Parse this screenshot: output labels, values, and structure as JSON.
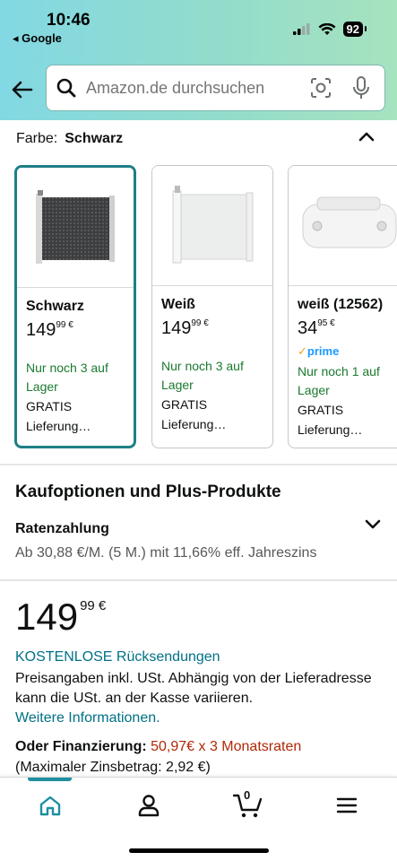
{
  "status": {
    "time": "10:46",
    "back_app": "◂ Google",
    "battery": "92"
  },
  "search": {
    "placeholder": "Amazon.de durchsuchen"
  },
  "color_selector": {
    "label": "Farbe:",
    "value": "Schwarz"
  },
  "variants": [
    {
      "name": "Schwarz",
      "price_main": "149",
      "price_cents": "99 €",
      "prime": "",
      "stock": "Nur noch 3 auf Lager",
      "delivery": "GRATIS",
      "delivery2": "Lieferung…"
    },
    {
      "name": "Weiß",
      "price_main": "149",
      "price_cents": "99 €",
      "prime": "",
      "stock": "Nur noch 3 auf Lager",
      "delivery": "GRATIS",
      "delivery2": "Lieferung…"
    },
    {
      "name": "weiß (12562)",
      "price_main": "34",
      "price_cents": "95 €",
      "prime": "prime",
      "stock": "Nur noch 1 auf Lager",
      "delivery": "GRATIS",
      "delivery2": "Lieferung…"
    }
  ],
  "purchase_options": {
    "title": "Kaufoptionen und Plus-Produkte",
    "installment_title": "Ratenzahlung",
    "installment_desc": "Ab 30,88 €/M. (5 M.) mit 11,66% eff. Jahreszins"
  },
  "price": {
    "main": "149",
    "cents": "99 €",
    "returns": "KOSTENLOSE Rücksendungen",
    "note": "Preisangaben inkl. USt. Abhängig von der Lieferadresse kann die USt. an der Kasse variieren.",
    "more_info": "Weitere Informationen.",
    "finance_label": "Oder Finanzierung:",
    "finance_value": "50,97€ x 3 Monatsraten",
    "max_interest": "(Maximaler Zinsbetrag: 2,92 €)"
  },
  "nav": {
    "cart_count": "0"
  },
  "colors": {
    "accent": "#1e7f86",
    "link": "#007185",
    "stock_green": "#1a7a2e",
    "price_red": "#b12704"
  }
}
